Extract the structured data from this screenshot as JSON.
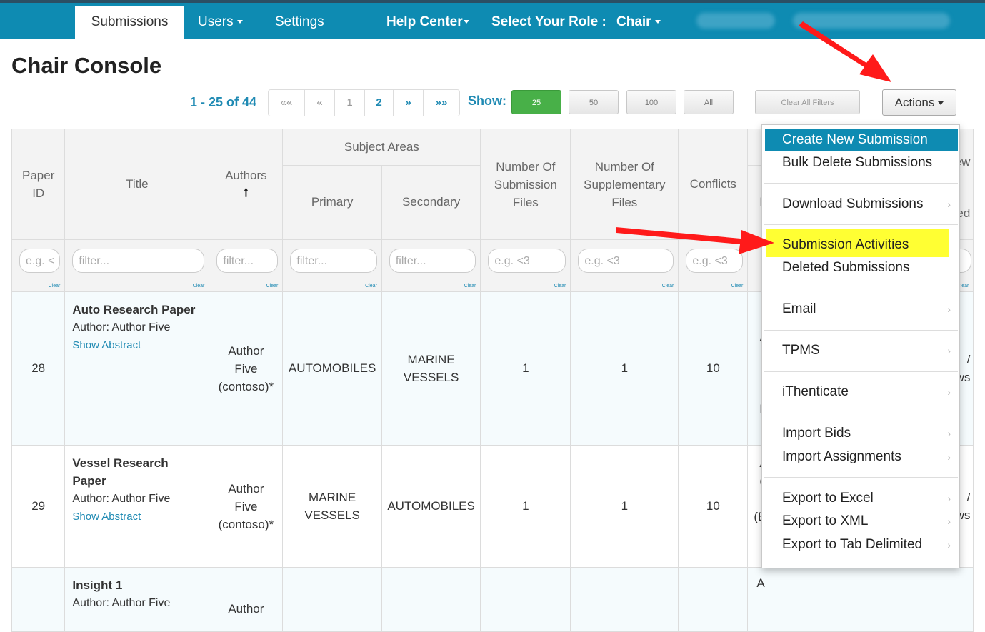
{
  "nav": {
    "submissions": "Submissions",
    "users": "Users",
    "settings": "Settings",
    "help_center": "Help Center",
    "role_label": "Select Your Role :",
    "role_value": "Chair"
  },
  "page_title": "Chair Console",
  "pagination": {
    "range": "1 - 25 of 44",
    "first": "««",
    "prev": "«",
    "page1": "1",
    "page2": "2",
    "next": "»",
    "last": "»»"
  },
  "show": {
    "label": "Show:",
    "opt25": "25",
    "opt50": "50",
    "opt100": "100",
    "optAll": "All"
  },
  "clear_all_filters": "Clear All Filters",
  "actions_label": "Actions",
  "columns": {
    "paper_id": "Paper ID",
    "title": "Title",
    "authors": "Authors",
    "sort_indicator": "🠕",
    "subject_areas": "Subject Areas",
    "primary": "Primary",
    "secondary": "Secondary",
    "submission_files": "Number Of Submission Files",
    "supplementary_files": "Number Of Supplementary Files",
    "conflicts": "Conflicts",
    "partial_next": "F",
    "partial_last": "ew",
    "partial_last2": "eted"
  },
  "filters": {
    "paper_id": "e.g. <",
    "text": "filter...",
    "number": "e.g. <3",
    "clear": "Clear"
  },
  "rows": [
    {
      "id": "28",
      "title": "Auto Research Paper",
      "author_line": "Author: Author Five",
      "show_abstract": "Show Abstract",
      "authors": "Author Five (contoso)*",
      "primary": "AUTOMOBILES",
      "secondary": "MARINE VESSELS",
      "sub_files": "1",
      "supp_files": "1",
      "conflicts": "10",
      "partial_a": "A",
      "partial_b": "R",
      "partial_c": "/",
      "partial_d": "ws"
    },
    {
      "id": "29",
      "title": "Vessel Research Paper",
      "author_line": "Author: Author Five",
      "show_abstract": "Show Abstract",
      "authors": "Author Five (contoso)*",
      "primary": "MARINE VESSELS",
      "secondary": "AUTOMOBILES",
      "sub_files": "1",
      "supp_files": "1",
      "conflicts": "10",
      "partial_a": "A",
      "partial_b": "(",
      "partial_e": "(B",
      "partial_c": "/",
      "partial_d": "ws"
    },
    {
      "title": "Insight 1",
      "author_line": "Author: Author Five",
      "authors": "Author",
      "partial_a": "A"
    }
  ],
  "actions_menu": {
    "create": "Create New Submission",
    "bulk_delete": "Bulk Delete Submissions",
    "download": "Download Submissions",
    "activities": "Submission Activities",
    "deleted": "Deleted Submissions",
    "email": "Email",
    "tpms": "TPMS",
    "ithenticate": "iThenticate",
    "import_bids": "Import Bids",
    "import_assignments": "Import Assignments",
    "export_excel": "Export to Excel",
    "export_xml": "Export to XML",
    "export_tab": "Export to Tab Delimited",
    "submenu_glyph": "›"
  },
  "colors": {
    "navbar": "#0e8bb2",
    "link": "#1f8ab3",
    "highlight": "#ffff33",
    "arrow": "#ff1a1a",
    "show_active": "#48b048"
  },
  "icons": [
    "caret-down-icon",
    "sort-up-arrow-icon",
    "chevron-right-icon",
    "red-arrow-annotation"
  ]
}
